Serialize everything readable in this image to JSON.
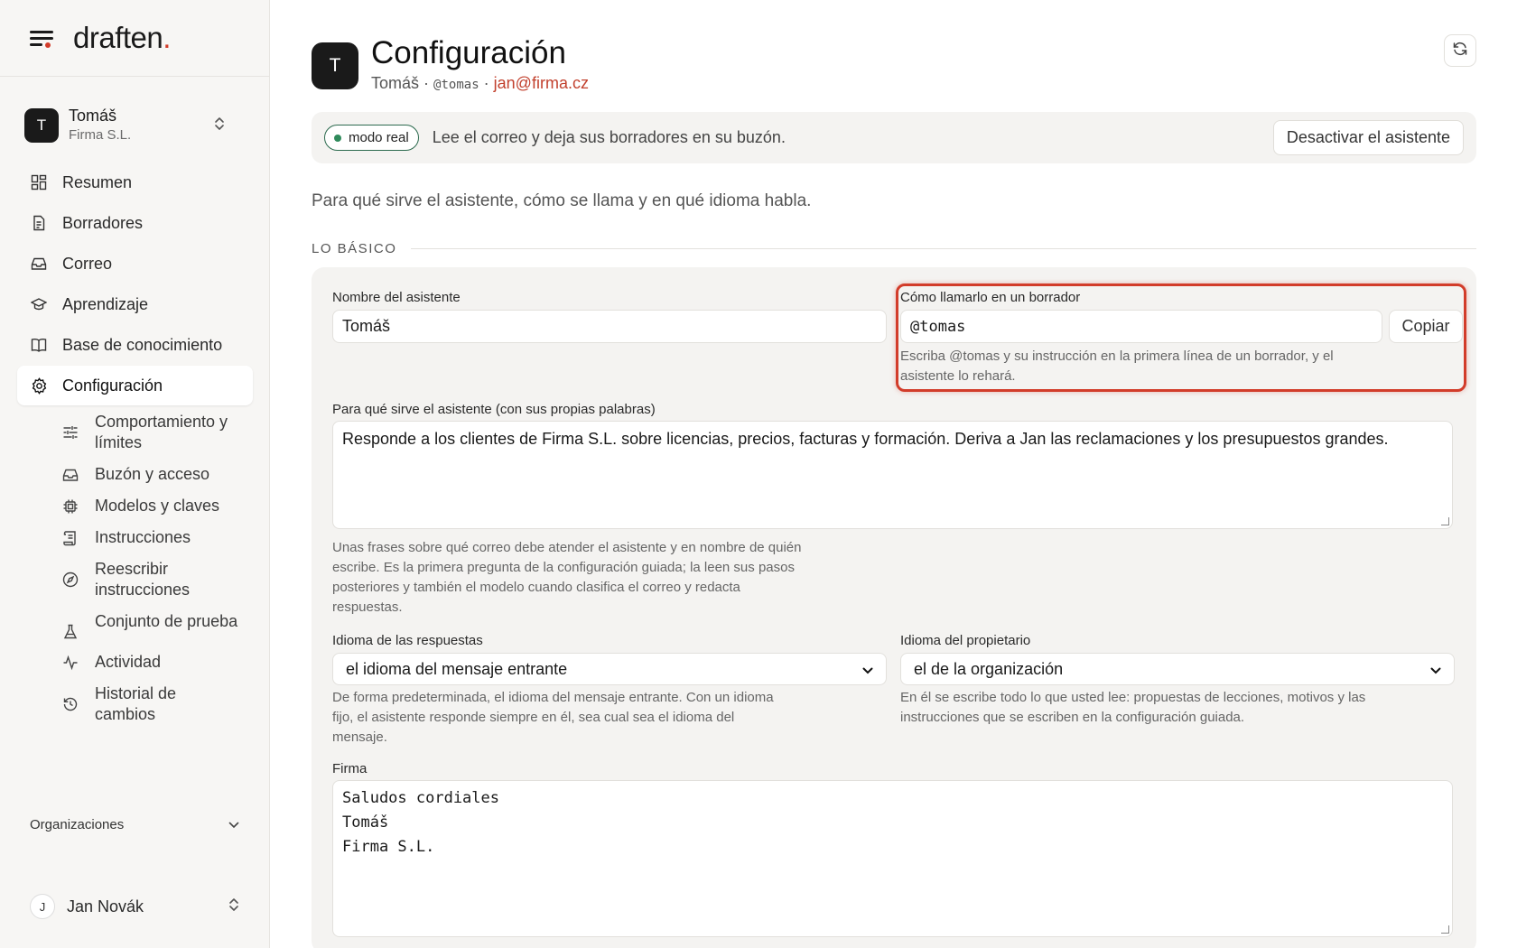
{
  "brand": {
    "name": "draften",
    "dot": "."
  },
  "account": {
    "name": "Tomáš",
    "org": "Firma S.L.",
    "initial": "T"
  },
  "nav": {
    "items": [
      {
        "label": "Resumen",
        "icon": "dashboard-icon"
      },
      {
        "label": "Borradores",
        "icon": "document-icon"
      },
      {
        "label": "Correo",
        "icon": "inbox-icon"
      },
      {
        "label": "Aprendizaje",
        "icon": "graduation-cap-icon"
      },
      {
        "label": "Base de conocimiento",
        "icon": "book-icon"
      },
      {
        "label": "Configuración",
        "icon": "gear-icon"
      }
    ],
    "sub_items": [
      {
        "label": "Comportamiento y límites",
        "icon": "sliders-icon"
      },
      {
        "label": "Buzón y acceso",
        "icon": "inbox-icon"
      },
      {
        "label": "Modelos y claves",
        "icon": "chip-icon"
      },
      {
        "label": "Instrucciones",
        "icon": "scroll-icon"
      },
      {
        "label": "Reescribir instrucciones",
        "icon": "compass-icon"
      },
      {
        "label": "Conjunto de prueba",
        "icon": "flask-icon"
      },
      {
        "label": "Actividad",
        "icon": "activity-icon"
      },
      {
        "label": "Historial de cambios",
        "icon": "history-icon"
      }
    ],
    "organizations_label": "Organizaciones"
  },
  "user": {
    "name": "Jan Novák",
    "initial": "J"
  },
  "header": {
    "title": "Configuración",
    "initial": "T",
    "owner_name": "Tomáš",
    "separator": "·",
    "handle": "@tomas",
    "email": "jan@firma.cz"
  },
  "mode": {
    "pill": "modo real",
    "text": "Lee el correo y deja sus borradores en su buzón.",
    "deactivate": "Desactivar el asistente"
  },
  "intro": "Para qué sirve el asistente, cómo se llama y en qué idioma habla.",
  "section": {
    "label": "LO BÁSICO"
  },
  "form": {
    "name_label": "Nombre del asistente",
    "name_value": "Tomáš",
    "call_label": "Cómo llamarlo en un borrador",
    "call_value": "@tomas",
    "copy": "Copiar",
    "call_help": "Escriba @tomas y su instrucción en la primera línea de un borrador, y el asistente lo rehará.",
    "purpose_label": "Para qué sirve el asistente (con sus propias palabras)",
    "purpose_value": "Responde a los clientes de Firma S.L. sobre licencias, precios, facturas y formación. Deriva a Jan las reclamaciones y los presupuestos grandes.",
    "purpose_help": "Unas frases sobre qué correo debe atender el asistente y en nombre de quién escribe. Es la primera pregunta de la configuración guiada; la leen sus pasos posteriores y también el modelo cuando clasifica el correo y redacta respuestas.",
    "lang_label": "Idioma de las respuestas",
    "lang_value": "el idioma del mensaje entrante",
    "lang_help": "De forma predeterminada, el idioma del mensaje entrante. Con un idioma fijo, el asistente responde siempre en él, sea cual sea el idioma del mensaje.",
    "owner_lang_label": "Idioma del propietario",
    "owner_lang_value": "el de la organización",
    "owner_lang_help": "En él se escribe todo lo que usted lee: propuestas de lecciones, motivos y las instrucciones que se escriben en la configuración guiada.",
    "signature_label": "Firma",
    "signature_lines": [
      "Saludos cordiales",
      "Tomáš",
      "Firma S.L."
    ]
  },
  "colors": {
    "accent": "#d23c2a",
    "live": "#2f8a5b",
    "email": "#c2412e"
  }
}
